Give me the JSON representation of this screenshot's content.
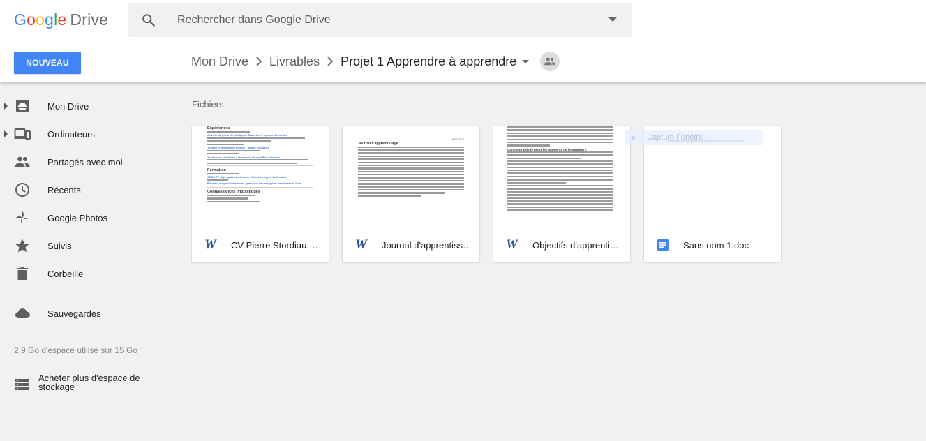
{
  "app": {
    "logo_letters": [
      "G",
      "o",
      "o",
      "g",
      "l",
      "e"
    ],
    "logo_product": "Drive",
    "search_placeholder": "Rechercher dans Google Drive",
    "new_button": "NOUVEAU"
  },
  "breadcrumb": {
    "items": [
      "Mon Drive",
      "Livrables",
      "Projet 1 Apprendre à apprendre"
    ],
    "shared_icon": "people-icon"
  },
  "sidebar": {
    "items": [
      {
        "label": "Mon Drive",
        "icon": "drive-icon",
        "expandable": true
      },
      {
        "label": "Ordinateurs",
        "icon": "computers-icon",
        "expandable": true
      },
      {
        "label": "Partagés avec moi",
        "icon": "people-icon",
        "expandable": false
      },
      {
        "label": "Récents",
        "icon": "clock-icon",
        "expandable": false
      },
      {
        "label": "Google Photos",
        "icon": "pinwheel-icon",
        "expandable": false
      },
      {
        "label": "Suivis",
        "icon": "star-icon",
        "expandable": false
      },
      {
        "label": "Corbeille",
        "icon": "trash-icon",
        "expandable": false
      }
    ],
    "backups": {
      "label": "Sauvegardes",
      "icon": "cloud-icon"
    },
    "storage_text": "2,9 Go d'espace utilisé sur 15 Go",
    "buy_storage": {
      "label": "Acheter plus d'espace de stockage",
      "icon": "storage-icon"
    }
  },
  "main": {
    "section_title": "Fichiers",
    "files": [
      {
        "name": "CV Pierre Stordiau.docx",
        "type": "word",
        "preview": {
          "heading": "Expériences",
          "entry1": "Ouvrier de propreté publique / Bruxelles-Propreté, Bruxelles",
          "entry2": "Testeur d'application mobile / Tappa, Bruxelles",
          "entry3": "Technicien chimiste / Laboratoire Raman Pals, Nivelles",
          "heading2": "Formation",
          "entry4": "CESS ET CQ6 option technicien chimiste / Lycée La Renaite",
          "entry5": "Étudiant à OpenClassrooms (parcours Développeur d'application Java)",
          "heading3": "Connaissances linguistiques"
        }
      },
      {
        "name": "Journal d'apprentissage.docx",
        "type": "word",
        "preview": {
          "heading": "Journal d'apprentissage",
          "date": "18/03/2018"
        }
      },
      {
        "name": "Objectifs d'apprentissage.docx",
        "type": "word",
        "preview": {
          "heading": "Comment vais-je gérer les moments de frustration ?",
          "heading2": "Accepter la frustration"
        }
      },
      {
        "name": "Sans nom 1.doc",
        "type": "gdoc",
        "preview": {}
      }
    ],
    "overlay_label": "Capture Fenêtre"
  },
  "colors": {
    "accent": "#4285f4",
    "word": "#2b579a",
    "gdoc": "#4285f4"
  }
}
